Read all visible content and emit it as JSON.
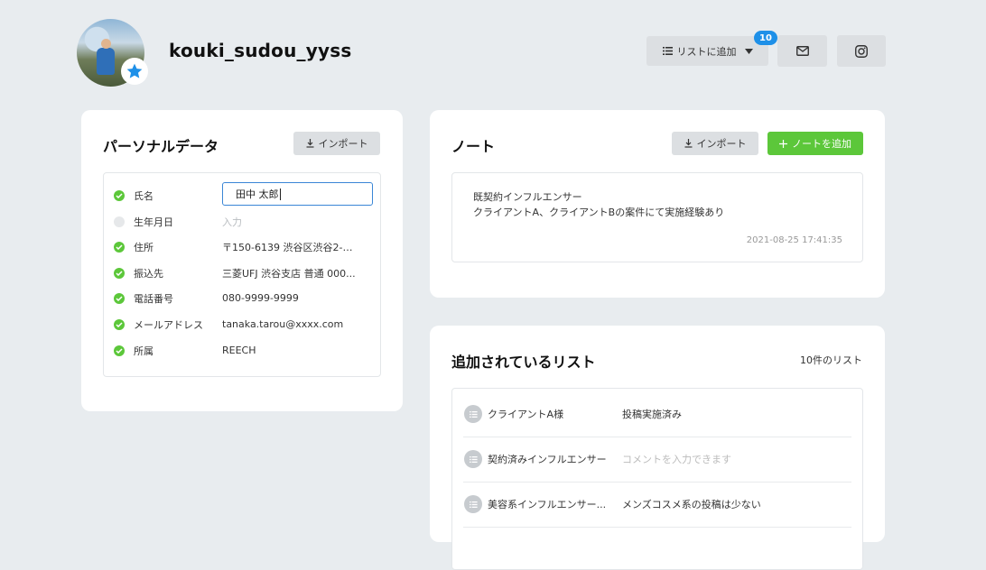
{
  "header": {
    "username": "kouki_sudou_yyss",
    "add_to_list_label": "リストに追加",
    "list_badge_count": "10"
  },
  "personal": {
    "title": "パーソナルデータ",
    "import_label": "インポート",
    "fields": [
      {
        "label": "氏名",
        "value": "田中 太郎",
        "checked": true
      },
      {
        "label": "生年月日",
        "value": "",
        "placeholder": "入力",
        "checked": false
      },
      {
        "label": "住所",
        "value": "〒150-6139 渋谷区渋谷2-24...",
        "checked": true
      },
      {
        "label": "振込先",
        "value": "三菱UFJ 渋谷支店 普通 000...",
        "checked": true
      },
      {
        "label": "電話番号",
        "value": "080-9999-9999",
        "checked": true
      },
      {
        "label": "メールアドレス",
        "value": "tanaka.tarou@xxxx.com",
        "checked": true
      },
      {
        "label": "所属",
        "value": "REECH",
        "checked": true
      }
    ]
  },
  "notes": {
    "title": "ノート",
    "import_label": "インポート",
    "add_label": "ノートを追加",
    "items": [
      {
        "line1": "既契約インフルエンサー",
        "line2": "クライアントA、クライアントBの案件にて実施経験あり",
        "date": "2021-08-25 17:41:35"
      }
    ]
  },
  "lists": {
    "title": "追加されているリスト",
    "count_label": "10件のリスト",
    "items": [
      {
        "name": "クライアントA様",
        "comment": "投稿実施済み",
        "placeholder": false
      },
      {
        "name": "契約済みインフルエンサー",
        "comment": "コメントを入力できます",
        "placeholder": true
      },
      {
        "name": "美容系インフルエンサー...",
        "comment": "メンズコスメ系の投稿は少ない",
        "placeholder": false
      }
    ]
  },
  "colors": {
    "accent_green": "#5cc73a",
    "accent_blue": "#1e90e8",
    "background": "#e8ecef"
  }
}
